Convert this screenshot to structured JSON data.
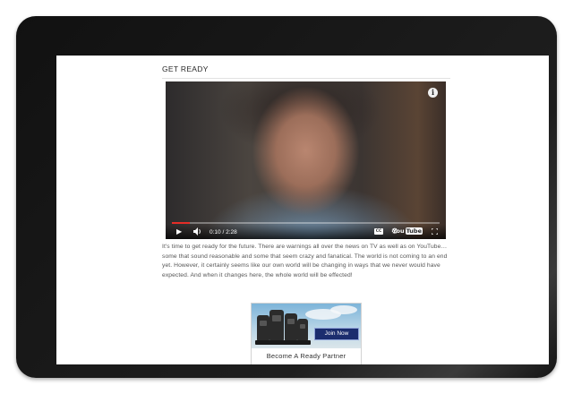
{
  "section": {
    "title": "GET READY"
  },
  "video": {
    "info_glyph": "i",
    "time": "0:10 / 2:28",
    "progress_fraction": 0.068,
    "cc_glyph": "CC",
    "youtube_you": "You",
    "youtube_tube": "Tube",
    "icons": [
      "play-icon",
      "volume-icon",
      "captions-icon",
      "gear-icon",
      "youtube-logo",
      "fullscreen-icon",
      "info-icon"
    ],
    "colors": {
      "progress": "#e52d27"
    }
  },
  "article": {
    "text": "It's time to get ready for the future. There are warnings all over the news on TV as well as on YouTube… some that sound reasonable and some that seem crazy and fanatical.  The world is not coming to an end yet. However, it certainly seems like our own world will be changing in ways that we never would have expected.  And when it changes here, the whole world will be effected!"
  },
  "banner": {
    "button_label": "Join Now",
    "caption": "Become A Ready Partner",
    "colors": {
      "button": "#1b2d6e"
    }
  }
}
